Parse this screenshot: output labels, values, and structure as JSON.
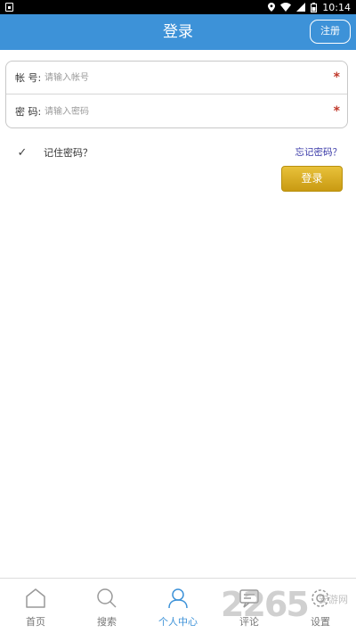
{
  "status_bar": {
    "time": "10:14"
  },
  "header": {
    "title": "登录",
    "register_label": "注册"
  },
  "form": {
    "account": {
      "label": "帐 号:",
      "placeholder": "请输入帐号",
      "required_mark": "*"
    },
    "password": {
      "label": "密 码:",
      "placeholder": "请输入密码",
      "required_mark": "*"
    }
  },
  "remember": {
    "checked": true,
    "check_glyph": "✓",
    "label": "记住密码？"
  },
  "forgot_label": "忘记密码？",
  "login_button_label": "登录",
  "nav": {
    "items": [
      {
        "label": "首页",
        "icon": "home-icon",
        "active": false
      },
      {
        "label": "搜索",
        "icon": "search-icon",
        "active": false
      },
      {
        "label": "个人中心",
        "icon": "user-icon",
        "active": true
      },
      {
        "label": "评论",
        "icon": "comment-icon",
        "active": false
      },
      {
        "label": "设置",
        "icon": "settings-icon",
        "active": false
      }
    ]
  },
  "watermark": {
    "text": "2265",
    "suffix": "安游网"
  },
  "colors": {
    "primary": "#3d92d8",
    "button_gold": "#d9ab22",
    "required_red": "#c0392b",
    "link": "#3a3aa8"
  }
}
